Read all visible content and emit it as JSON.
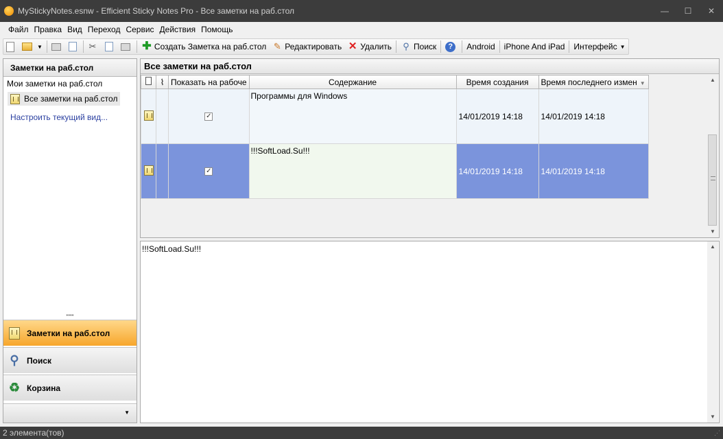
{
  "window": {
    "title": "MyStickyNotes.esnw - Efficient Sticky Notes Pro - Все заметки на раб.стол",
    "controls": {
      "minimize": "—",
      "maximize": "☐",
      "close": "✕"
    }
  },
  "menu": [
    "Файл",
    "Правка",
    "Вид",
    "Переход",
    "Сервис",
    "Действия",
    "Помощь"
  ],
  "toolbar": {
    "create_label": "Создать Заметка на раб.стол",
    "edit_label": "Редактировать",
    "delete_label": "Удалить",
    "search_label": "Поиск",
    "help_label": "?",
    "android_label": "Android",
    "iphone_label": "iPhone And iPad",
    "interface_label": "Интерфейс"
  },
  "left_panel": {
    "header": "Заметки на раб.стол",
    "group": "Мои заметки на раб.стол",
    "item": "Все заметки на раб.стол",
    "customize_link": "Настроить текущий вид...",
    "nav": [
      {
        "label": "Заметки на раб.стол",
        "icon": "notes-icon"
      },
      {
        "label": "Поиск",
        "icon": "search-icon"
      },
      {
        "label": "Корзина",
        "icon": "recycle-bin-icon"
      }
    ]
  },
  "grid": {
    "title": "Все заметки на раб.стол",
    "columns": [
      "",
      "",
      "Показать на рабоче",
      "Содержание",
      "Время создания",
      "Время последнего измен"
    ],
    "rows": [
      {
        "show_on_desktop": "✓",
        "content": "Программы для Windows",
        "created": "14/01/2019 14:18",
        "modified": "14/01/2019 14:18"
      },
      {
        "show_on_desktop": "✓",
        "content": "!!!SoftLoad.Su!!!",
        "created": "14/01/2019 14:18",
        "modified": "14/01/2019 14:18"
      }
    ]
  },
  "preview": {
    "text": "!!!SoftLoad.Su!!!"
  },
  "status": {
    "text": "2 элемента(тов)"
  }
}
